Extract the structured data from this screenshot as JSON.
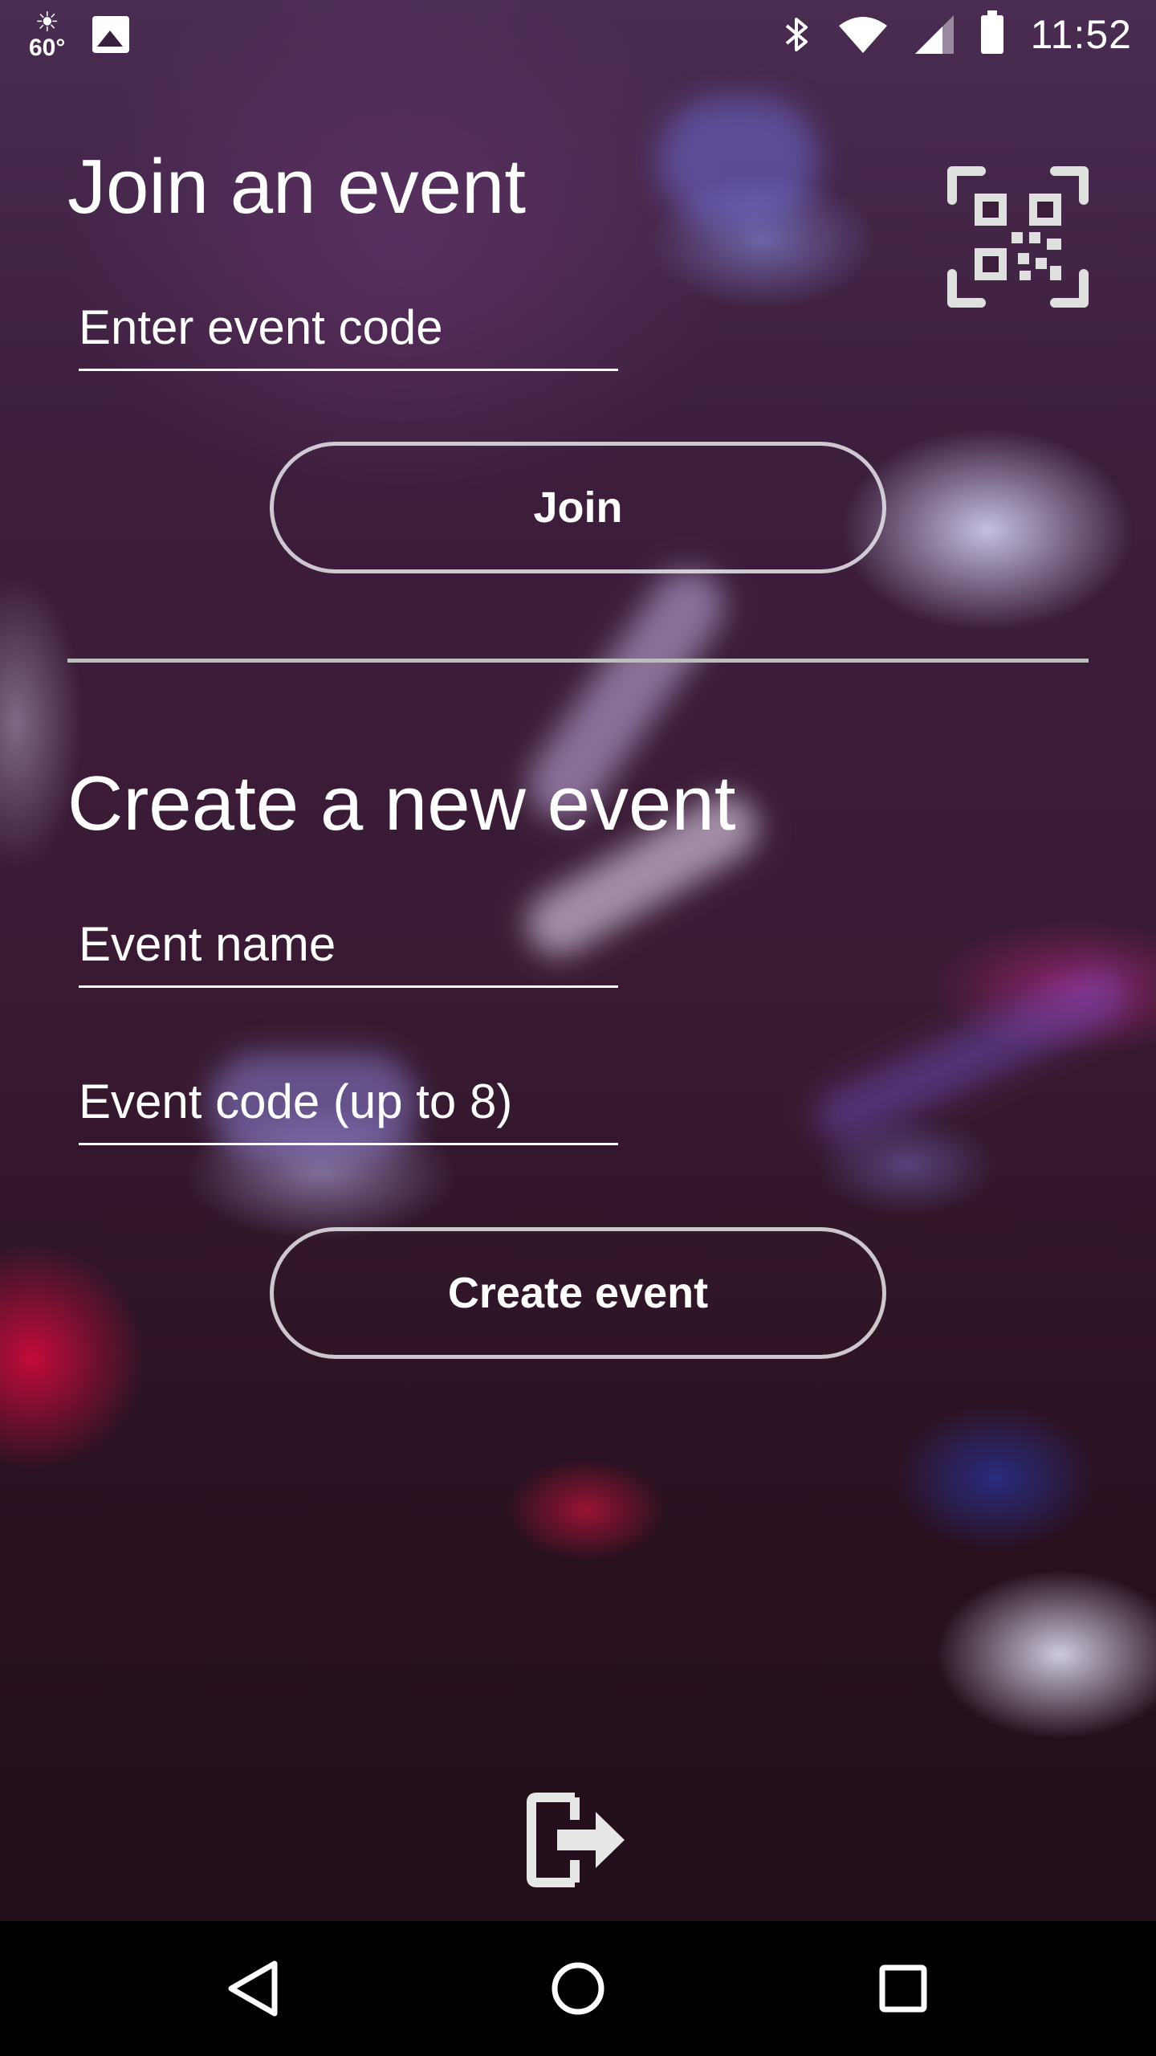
{
  "status_bar": {
    "weather_temp": "60°",
    "time": "11:52",
    "icons": [
      "weather-sun-icon",
      "image-notification-icon",
      "bluetooth-icon",
      "wifi-icon",
      "cell-signal-icon",
      "battery-icon"
    ]
  },
  "join_section": {
    "title": "Join an event",
    "code_placeholder": "Enter event code",
    "join_label": "Join",
    "qr_icon": "qr-code-scan-icon"
  },
  "create_section": {
    "title": "Create a new event",
    "name_placeholder": "Event name",
    "code_placeholder": "Event code (up to 8)",
    "create_label": "Create event"
  },
  "footer": {
    "logout_icon": "logout-icon"
  },
  "nav_bar": {
    "icons": [
      "back-icon",
      "home-icon",
      "recents-icon"
    ]
  },
  "colors": {
    "text": "#ffffff",
    "button_border": "#e6e6eb",
    "divider": "#bdbdbd",
    "nav_bar": "#000000"
  }
}
